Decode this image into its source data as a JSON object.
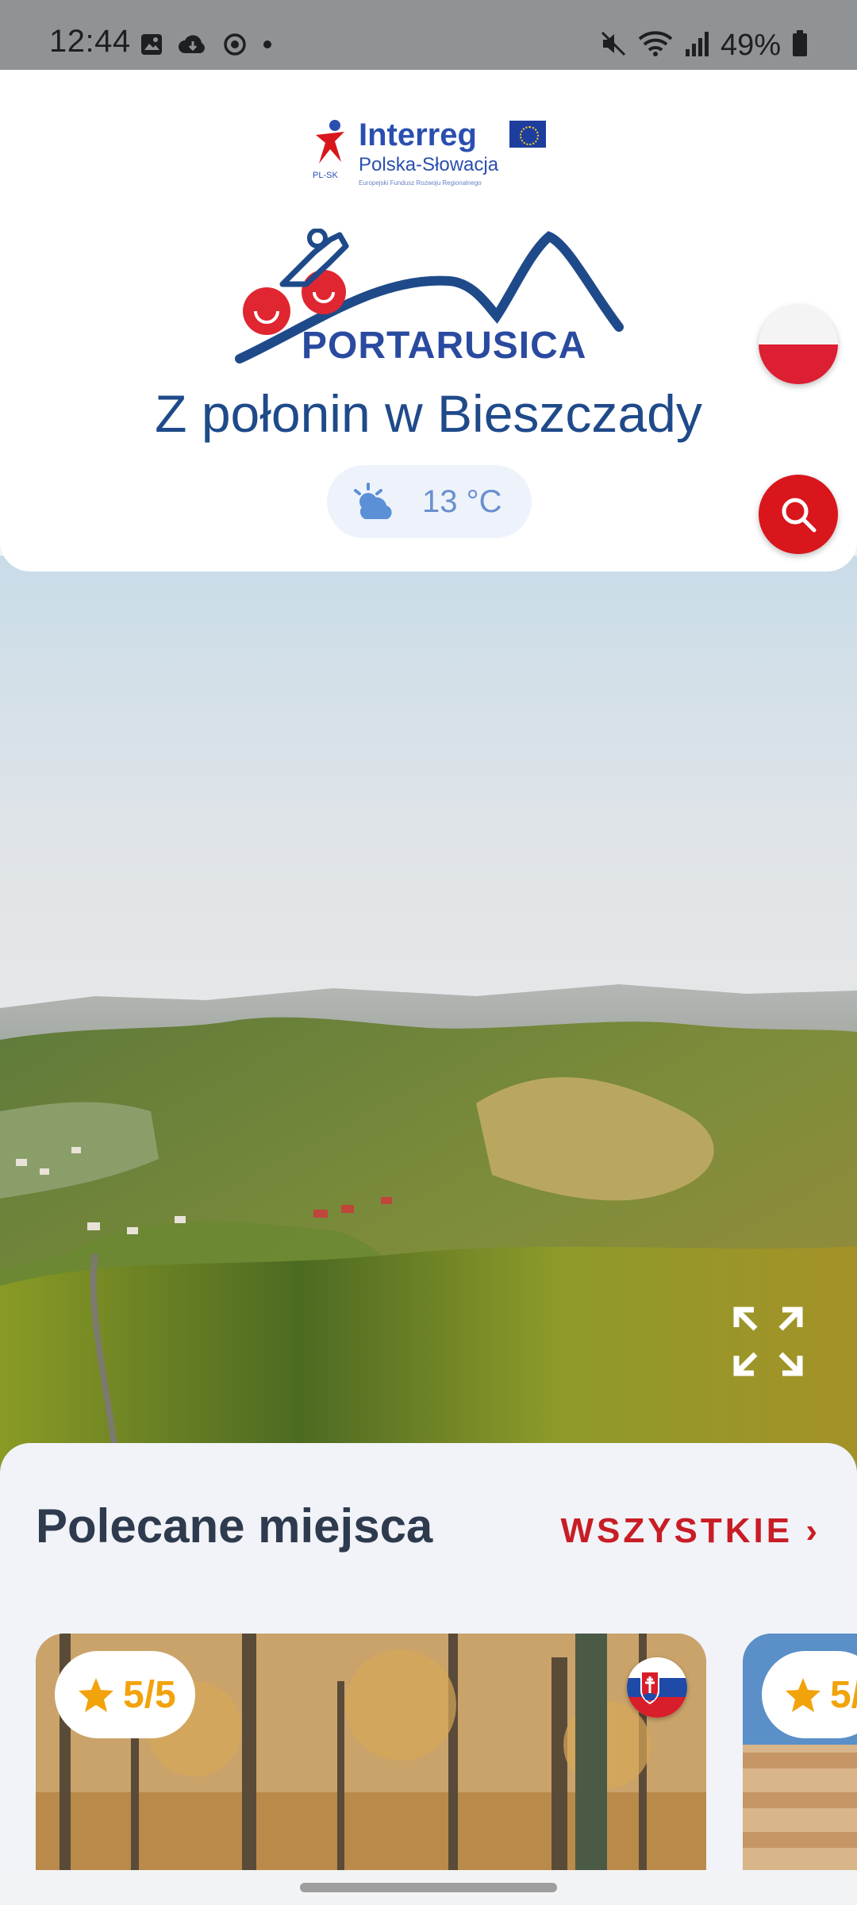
{
  "status_bar": {
    "time": "12:44",
    "battery": "49%",
    "left_icons": [
      "image-icon",
      "cloud-download-icon",
      "sync-icon",
      "dot-icon"
    ],
    "right_icons": [
      "mute-icon",
      "wifi-icon",
      "signal-icon",
      "battery-icon"
    ]
  },
  "header": {
    "sponsor_brand": "Interreg",
    "sponsor_sub": "Polska-Słowacja",
    "sponsor_fineprint": "Europejski Fundusz Rozwoju Regionalnego",
    "sponsor_mark": "PL-SK",
    "logo_text": "PORTARUSICA",
    "tagline": "Z połonin w Bieszczady",
    "weather": {
      "icon": "partly-cloudy-icon",
      "temperature": "13 °C"
    },
    "language_flag": "poland-flag-icon"
  },
  "colors": {
    "accent_red": "#d8161c",
    "brand_blue": "#1f4a8a",
    "rating_orange": "#f2a30c",
    "title_dark": "#2e3a4e"
  },
  "hero": {
    "image": "aerial-mountain-forest-landscape",
    "fullscreen_icon": "fullscreen-expand-icon"
  },
  "recommended": {
    "title": "Polecane miejsca",
    "see_all": "WSZYSTKIE ›",
    "cards": [
      {
        "rating": "5/5",
        "country_badge": "slovakia-flag-icon",
        "image": "autumn-forest"
      },
      {
        "rating": "5/",
        "image": "wooden-structure"
      }
    ]
  }
}
